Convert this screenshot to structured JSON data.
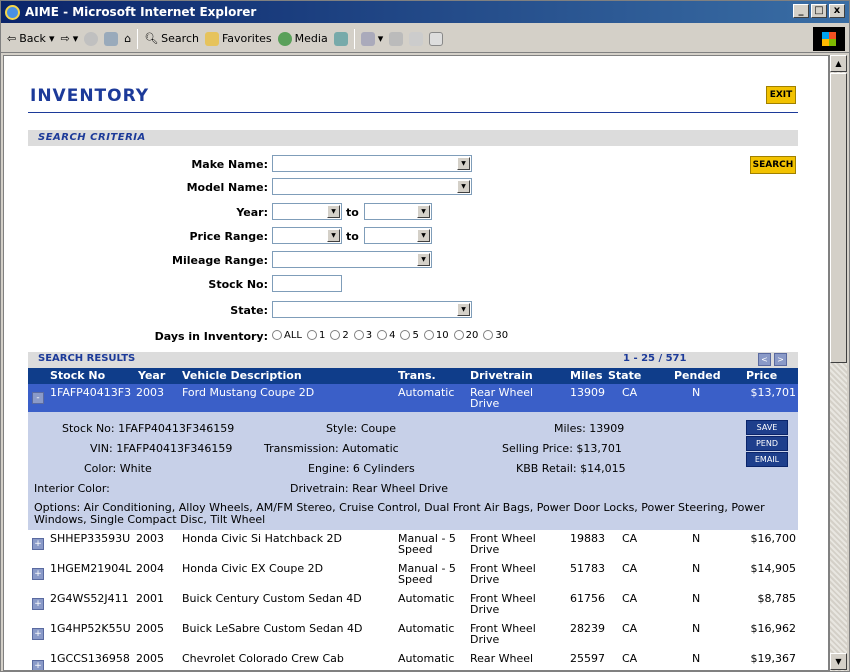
{
  "window": {
    "title": "AIME - Microsoft Internet Explorer",
    "minimize": "_",
    "maximize": "□",
    "close": "x"
  },
  "toolbar": {
    "back": "Back",
    "search": "Search",
    "favorites": "Favorites",
    "media": "Media"
  },
  "page": {
    "title": "INVENTORY",
    "exit": "EXIT"
  },
  "search": {
    "section_title": "SEARCH CRITERIA",
    "make_label": "Make Name:",
    "model_label": "Model Name:",
    "year_label": "Year:",
    "to": "to",
    "price_label": "Price Range:",
    "mileage_label": "Mileage Range:",
    "stock_label": "Stock No:",
    "state_label": "State:",
    "days_label": "Days in Inventory:",
    "days_options": [
      "ALL",
      "1",
      "2",
      "3",
      "4",
      "5",
      "10",
      "20",
      "30"
    ],
    "button": "SEARCH"
  },
  "results": {
    "section_title": "SEARCH RESULTS",
    "count": "1 - 25 / 571",
    "prev": "<",
    "next": ">",
    "columns": {
      "stock": "Stock No",
      "year": "Year",
      "desc": "Vehicle Description",
      "trans": "Trans.",
      "drive": "Drivetrain",
      "miles": "Miles",
      "state": "State",
      "pended": "Pended",
      "price": "Price"
    },
    "rows": [
      {
        "toggle": "-",
        "stock": "1FAFP40413F3",
        "year": "2003",
        "desc": "Ford Mustang Coupe 2D",
        "trans": "Automatic",
        "trans2": "",
        "drive": "Rear Wheel",
        "drive2": "Drive",
        "miles": "13909",
        "state": "CA",
        "pended": "N",
        "price": "$13,701"
      },
      {
        "toggle": "+",
        "stock": "SHHEP33593U",
        "year": "2003",
        "desc": "Honda Civic Si Hatchback 2D",
        "trans": "Manual - 5",
        "trans2": "Speed",
        "drive": "Front Wheel",
        "drive2": "Drive",
        "miles": "19883",
        "state": "CA",
        "pended": "N",
        "price": "$16,700"
      },
      {
        "toggle": "+",
        "stock": "1HGEM21904L",
        "year": "2004",
        "desc": "Honda Civic EX Coupe 2D",
        "trans": "Manual - 5",
        "trans2": "Speed",
        "drive": "Front Wheel",
        "drive2": "Drive",
        "miles": "51783",
        "state": "CA",
        "pended": "N",
        "price": "$14,905"
      },
      {
        "toggle": "+",
        "stock": "2G4WS52J411",
        "year": "2001",
        "desc": "Buick Century Custom Sedan 4D",
        "trans": "Automatic",
        "trans2": "",
        "drive": "Front Wheel",
        "drive2": "Drive",
        "miles": "61756",
        "state": "CA",
        "pended": "N",
        "price": "$8,785"
      },
      {
        "toggle": "+",
        "stock": "1G4HP52K55U",
        "year": "2005",
        "desc": "Buick LeSabre Custom Sedan 4D",
        "trans": "Automatic",
        "trans2": "",
        "drive": "Front Wheel",
        "drive2": "Drive",
        "miles": "28239",
        "state": "CA",
        "pended": "N",
        "price": "$16,962"
      },
      {
        "toggle": "+",
        "stock": "1GCCS136958",
        "year": "2005",
        "desc": "Chevrolet Colorado Crew Cab",
        "trans": "Automatic",
        "trans2": "",
        "drive": "Rear Wheel",
        "drive2": "",
        "miles": "25597",
        "state": "CA",
        "pended": "N",
        "price": "$19,367"
      }
    ],
    "detail": {
      "stock": "Stock No: 1FAFP40413F346159",
      "vin": "VIN: 1FAFP40413F346159",
      "color": "Color: White",
      "interior": "Interior Color:",
      "style": "Style: Coupe",
      "transmission": "Transmission: Automatic",
      "engine": "Engine: 6 Cylinders",
      "drivetrain": "Drivetrain: Rear Wheel Drive",
      "miles": "Miles: 13909",
      "selling": "Selling Price: $13,701",
      "kbb": "KBB Retail: $14,015",
      "options": "Options: Air Conditioning, Alloy Wheels, AM/FM Stereo, Cruise Control, Dual Front Air Bags, Power Door Locks, Power Steering, Power Windows, Single Compact Disc, Tilt Wheel",
      "save": "SAVE",
      "pend": "PEND",
      "email": "EMAIL"
    }
  }
}
